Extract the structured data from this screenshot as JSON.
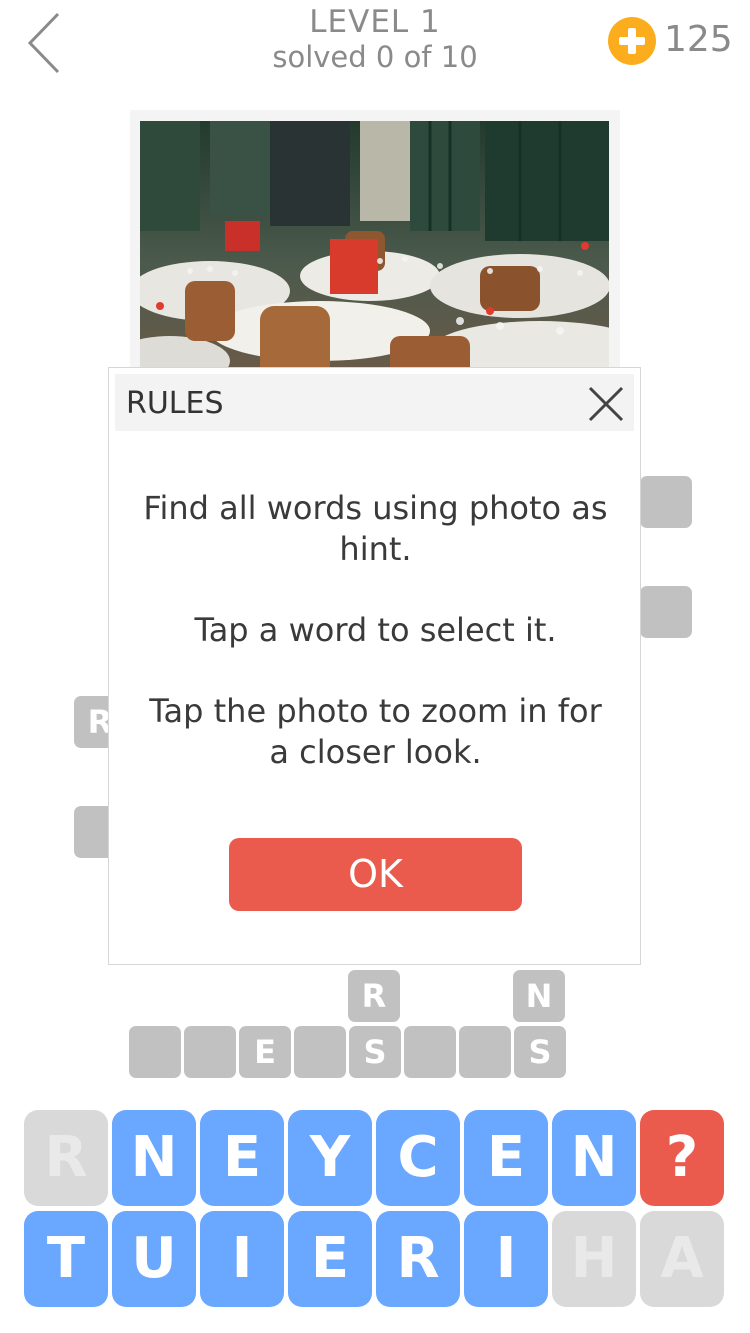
{
  "header": {
    "level_title": "LEVEL 1",
    "progress": "solved 0 of 10",
    "coins": "125",
    "back_icon": "chevron-left-icon",
    "coin_icon": "plus-coin-icon"
  },
  "board": {
    "tiles": [
      "",
      "",
      "",
      "R",
      "",
      "",
      "",
      "",
      "E",
      "",
      "R",
      "S",
      "",
      "",
      "N",
      "S"
    ]
  },
  "dialog": {
    "title": "RULES",
    "line1": "Find all words using photo as hint.",
    "line2": "Tap a word to select it.",
    "line3": "Tap the photo to zoom in for a closer look.",
    "ok_label": "OK"
  },
  "keyboard": {
    "row1": [
      "R",
      "N",
      "E",
      "Y",
      "C",
      "E",
      "N",
      "?"
    ],
    "row2": [
      "T",
      "U",
      "I",
      "E",
      "R",
      "I",
      "H",
      "A"
    ]
  },
  "colors": {
    "key_blue": "#6aa7ff",
    "accent_red": "#ea5b4d",
    "coin_orange": "#fbad1e",
    "tile_gray": "#c1c1c1"
  }
}
